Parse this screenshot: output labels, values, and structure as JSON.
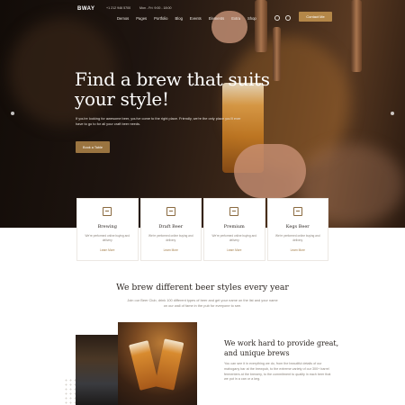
{
  "header": {
    "logo": "BWAY",
    "phone": "+1 212 946 5700",
    "hours": "Mon - Fri: 9:00 - 18:00",
    "nav": [
      "Demos",
      "Pages",
      "Portfolio",
      "Blog",
      "Events",
      "Elements",
      "Extra",
      "Shop"
    ],
    "contact_button": "Contact Me"
  },
  "hero": {
    "title": "Find a brew that suits your style!",
    "text": "If you're looking for awesome beer, you've come to the right place. Friendly, we're the only place you'll ever have to go to for all your craft beer needs.",
    "button": "Book a Table"
  },
  "cards": [
    {
      "title": "Brewing",
      "desc": "We're performed online buying and delivery",
      "link": "Learn More"
    },
    {
      "title": "Draft Beer",
      "desc": "We're performed online buying and delivery",
      "link": "Learn More"
    },
    {
      "title": "Premium",
      "desc": "We're performed online buying and delivery",
      "link": "Learn More"
    },
    {
      "title": "Kegs Beer",
      "desc": "We're performed online buying and delivery",
      "link": "Learn More"
    }
  ],
  "styles_section": {
    "title": "We brew different beer styles every year",
    "text": "Join our Beer Club, drink 100 different types of beer and get your name on the list and your name on our wall of fame in the pub for everyone to see."
  },
  "great_section": {
    "title": "We work hard to provide great, and unique brews",
    "text": "You can see it in everything we do, from the beautiful details of our mahogany bar at the brewpub, to the extreme variety of our 300+ barrel fermenters at the brewery, to the commitment to quality in each beer that we put in a can or a keg."
  },
  "colors": {
    "accent": "#b48748",
    "dark_text": "#2b2521",
    "muted_text": "#8b837b"
  }
}
